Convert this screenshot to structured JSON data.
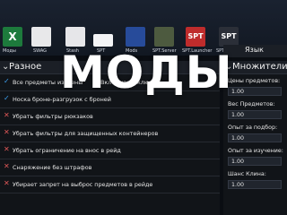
{
  "desktop": {
    "icons": [
      {
        "name": "excel-icon",
        "label": "Моды",
        "glyph": "X"
      },
      {
        "name": "folder-icon",
        "label": "SWAG"
      },
      {
        "name": "folder-icon-2",
        "label": "Stash"
      },
      {
        "name": "document-icon",
        "label": "SPT"
      },
      {
        "name": "crystal-icon",
        "label": "Mods"
      },
      {
        "name": "soldier-icon",
        "label": "SPT.Server"
      },
      {
        "name": "spt-launcher-icon",
        "label": "SPT.Launcher",
        "glyph": "SPT"
      },
      {
        "name": "spt-icon",
        "label": "SPT.Launcher",
        "glyph": "SPT"
      }
    ]
  },
  "overlay_title": "МОДЫ",
  "language_bar": {
    "label": "Язык"
  },
  "left_panel": {
    "title": "Разное",
    "chevron": "⌄",
    "rows": [
      {
        "mark": "✓",
        "label": "Все предметы изучены",
        "extra_mark": "✕",
        "extra": "Вклчючая к ключи"
      },
      {
        "mark": "✓",
        "label": "Носка броне-разгрузок с броней"
      },
      {
        "mark": "✕",
        "label": "Убрать фильтры рюкзаков"
      },
      {
        "mark": "✕",
        "label": "Убрать фильтры для защищенных контейнеров"
      },
      {
        "mark": "✕",
        "label": "Убрать ограничение на внос в рейд"
      },
      {
        "mark": "✕",
        "label": "Снаряжение без штрафов"
      },
      {
        "mark": "✕",
        "label": "Убирает запрет на выброс предметов в рейде"
      }
    ]
  },
  "right_panel": {
    "title": "Множители",
    "chevron": "⌄",
    "fields": [
      {
        "label": "Цены предметов:",
        "value": "1.00"
      },
      {
        "label": "Вес Предметов:",
        "value": "1.00"
      },
      {
        "label": "Опыт за подбор:",
        "value": "1.00"
      },
      {
        "label": "Опыт за изучение:",
        "value": "1.00"
      },
      {
        "label": "Шанс Клина:",
        "value": "1.00"
      }
    ]
  }
}
